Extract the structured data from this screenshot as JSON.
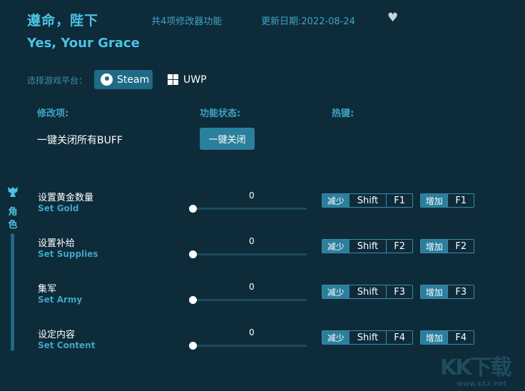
{
  "header": {
    "title_cn": "遵命，陛下",
    "title_en": "Yes, Your Grace",
    "feature_count": "共4项修改器功能",
    "update_date": "更新日期:2022-08-24",
    "heart_icon": "heart-icon"
  },
  "platform": {
    "label": "选择游戏平台：",
    "steam": "Steam",
    "uwp": "UWP"
  },
  "columns": {
    "modifier": "修改项:",
    "state": "功能状态:",
    "hotkey": "热键:"
  },
  "buff": {
    "label": "一键关闭所有BUFF",
    "button": "一键关闭"
  },
  "sidebar": {
    "label": "角色",
    "char1": "角",
    "char2": "色"
  },
  "rows": [
    {
      "cn": "设置黄金数量",
      "en": "Set Gold",
      "value": "0",
      "slider_level": 0,
      "dec": "减少",
      "mod": "Shift",
      "key1": "F1",
      "inc": "增加",
      "key2": "F1"
    },
    {
      "cn": "设置补给",
      "en": "Set Supplies",
      "value": "0",
      "slider_level": 0,
      "dec": "减少",
      "mod": "Shift",
      "key1": "F2",
      "inc": "增加",
      "key2": "F2"
    },
    {
      "cn": "集军",
      "en": "Set Army",
      "value": "0",
      "slider_level": 0,
      "dec": "减少",
      "mod": "Shift",
      "key1": "F3",
      "inc": "增加",
      "key2": "F3"
    },
    {
      "cn": "设定内容",
      "en": "Set Content",
      "value": "0",
      "slider_level": 0,
      "dec": "减少",
      "mod": "Shift",
      "key1": "F4",
      "inc": "增加",
      "key2": "F4"
    }
  ],
  "watermark": {
    "logo": "KK下载",
    "url": "www.kkx.net"
  },
  "colors": {
    "background": "#0e2b3a",
    "accent": "#4cc3e3",
    "button": "#2a7f9d"
  }
}
